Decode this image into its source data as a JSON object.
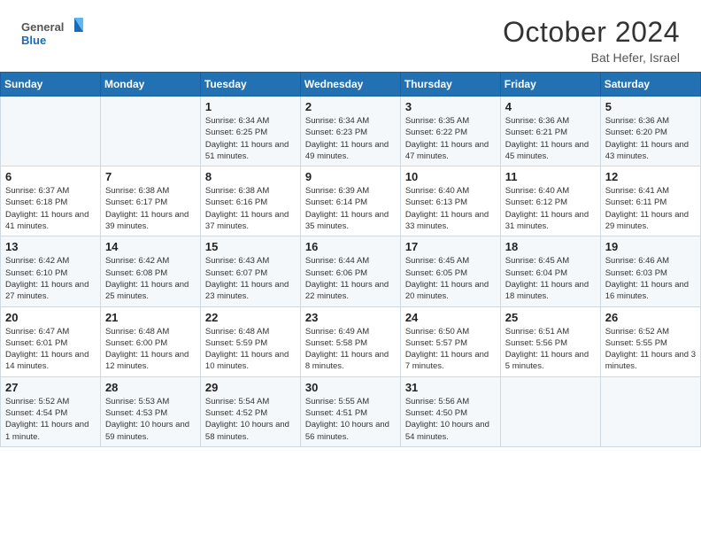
{
  "header": {
    "logo_general": "General",
    "logo_blue": "Blue",
    "month_title": "October 2024",
    "location": "Bat Hefer, Israel"
  },
  "days_of_week": [
    "Sunday",
    "Monday",
    "Tuesday",
    "Wednesday",
    "Thursday",
    "Friday",
    "Saturday"
  ],
  "weeks": [
    [
      {
        "day": "",
        "info": ""
      },
      {
        "day": "",
        "info": ""
      },
      {
        "day": "1",
        "info": "Sunrise: 6:34 AM\nSunset: 6:25 PM\nDaylight: 11 hours and 51 minutes."
      },
      {
        "day": "2",
        "info": "Sunrise: 6:34 AM\nSunset: 6:23 PM\nDaylight: 11 hours and 49 minutes."
      },
      {
        "day": "3",
        "info": "Sunrise: 6:35 AM\nSunset: 6:22 PM\nDaylight: 11 hours and 47 minutes."
      },
      {
        "day": "4",
        "info": "Sunrise: 6:36 AM\nSunset: 6:21 PM\nDaylight: 11 hours and 45 minutes."
      },
      {
        "day": "5",
        "info": "Sunrise: 6:36 AM\nSunset: 6:20 PM\nDaylight: 11 hours and 43 minutes."
      }
    ],
    [
      {
        "day": "6",
        "info": "Sunrise: 6:37 AM\nSunset: 6:18 PM\nDaylight: 11 hours and 41 minutes."
      },
      {
        "day": "7",
        "info": "Sunrise: 6:38 AM\nSunset: 6:17 PM\nDaylight: 11 hours and 39 minutes."
      },
      {
        "day": "8",
        "info": "Sunrise: 6:38 AM\nSunset: 6:16 PM\nDaylight: 11 hours and 37 minutes."
      },
      {
        "day": "9",
        "info": "Sunrise: 6:39 AM\nSunset: 6:14 PM\nDaylight: 11 hours and 35 minutes."
      },
      {
        "day": "10",
        "info": "Sunrise: 6:40 AM\nSunset: 6:13 PM\nDaylight: 11 hours and 33 minutes."
      },
      {
        "day": "11",
        "info": "Sunrise: 6:40 AM\nSunset: 6:12 PM\nDaylight: 11 hours and 31 minutes."
      },
      {
        "day": "12",
        "info": "Sunrise: 6:41 AM\nSunset: 6:11 PM\nDaylight: 11 hours and 29 minutes."
      }
    ],
    [
      {
        "day": "13",
        "info": "Sunrise: 6:42 AM\nSunset: 6:10 PM\nDaylight: 11 hours and 27 minutes."
      },
      {
        "day": "14",
        "info": "Sunrise: 6:42 AM\nSunset: 6:08 PM\nDaylight: 11 hours and 25 minutes."
      },
      {
        "day": "15",
        "info": "Sunrise: 6:43 AM\nSunset: 6:07 PM\nDaylight: 11 hours and 23 minutes."
      },
      {
        "day": "16",
        "info": "Sunrise: 6:44 AM\nSunset: 6:06 PM\nDaylight: 11 hours and 22 minutes."
      },
      {
        "day": "17",
        "info": "Sunrise: 6:45 AM\nSunset: 6:05 PM\nDaylight: 11 hours and 20 minutes."
      },
      {
        "day": "18",
        "info": "Sunrise: 6:45 AM\nSunset: 6:04 PM\nDaylight: 11 hours and 18 minutes."
      },
      {
        "day": "19",
        "info": "Sunrise: 6:46 AM\nSunset: 6:03 PM\nDaylight: 11 hours and 16 minutes."
      }
    ],
    [
      {
        "day": "20",
        "info": "Sunrise: 6:47 AM\nSunset: 6:01 PM\nDaylight: 11 hours and 14 minutes."
      },
      {
        "day": "21",
        "info": "Sunrise: 6:48 AM\nSunset: 6:00 PM\nDaylight: 11 hours and 12 minutes."
      },
      {
        "day": "22",
        "info": "Sunrise: 6:48 AM\nSunset: 5:59 PM\nDaylight: 11 hours and 10 minutes."
      },
      {
        "day": "23",
        "info": "Sunrise: 6:49 AM\nSunset: 5:58 PM\nDaylight: 11 hours and 8 minutes."
      },
      {
        "day": "24",
        "info": "Sunrise: 6:50 AM\nSunset: 5:57 PM\nDaylight: 11 hours and 7 minutes."
      },
      {
        "day": "25",
        "info": "Sunrise: 6:51 AM\nSunset: 5:56 PM\nDaylight: 11 hours and 5 minutes."
      },
      {
        "day": "26",
        "info": "Sunrise: 6:52 AM\nSunset: 5:55 PM\nDaylight: 11 hours and 3 minutes."
      }
    ],
    [
      {
        "day": "27",
        "info": "Sunrise: 5:52 AM\nSunset: 4:54 PM\nDaylight: 11 hours and 1 minute."
      },
      {
        "day": "28",
        "info": "Sunrise: 5:53 AM\nSunset: 4:53 PM\nDaylight: 10 hours and 59 minutes."
      },
      {
        "day": "29",
        "info": "Sunrise: 5:54 AM\nSunset: 4:52 PM\nDaylight: 10 hours and 58 minutes."
      },
      {
        "day": "30",
        "info": "Sunrise: 5:55 AM\nSunset: 4:51 PM\nDaylight: 10 hours and 56 minutes."
      },
      {
        "day": "31",
        "info": "Sunrise: 5:56 AM\nSunset: 4:50 PM\nDaylight: 10 hours and 54 minutes."
      },
      {
        "day": "",
        "info": ""
      },
      {
        "day": "",
        "info": ""
      }
    ]
  ]
}
